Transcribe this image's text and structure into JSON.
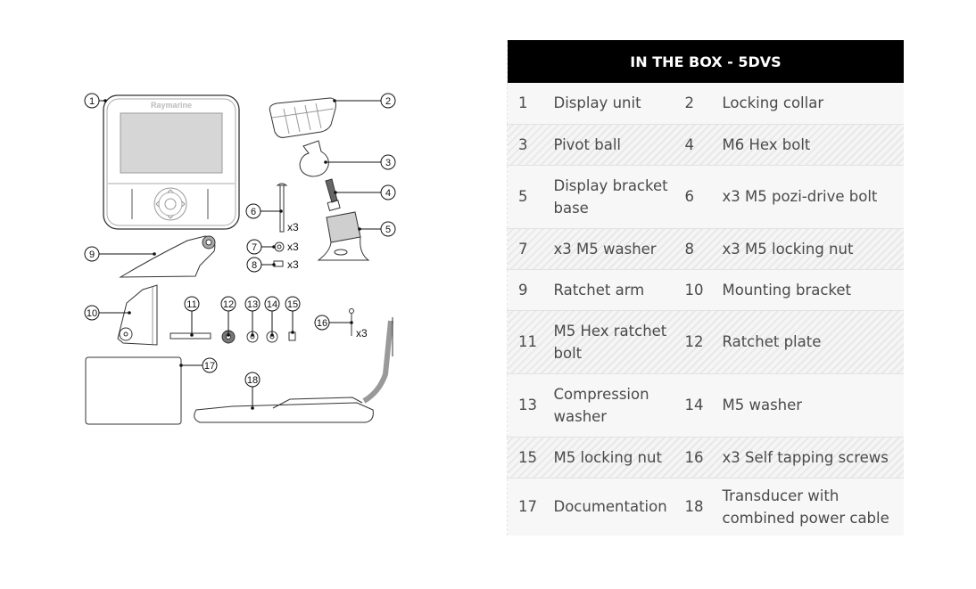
{
  "table": {
    "title": "IN THE BOX - 5DVS",
    "rows": [
      {
        "n1": "1",
        "l1": "Display unit",
        "n2": "2",
        "l2": "Locking collar"
      },
      {
        "n1": "3",
        "l1": "Pivot ball",
        "n2": "4",
        "l2": "M6 Hex bolt"
      },
      {
        "n1": "5",
        "l1": "Display bracket base",
        "n2": "6",
        "l2": "x3 M5 pozi-drive bolt"
      },
      {
        "n1": "7",
        "l1": "x3 M5 washer",
        "n2": "8",
        "l2": "x3 M5 locking nut"
      },
      {
        "n1": "9",
        "l1": "Ratchet arm",
        "n2": "10",
        "l2": "Mounting bracket"
      },
      {
        "n1": "11",
        "l1": "M5 Hex ratchet bolt",
        "n2": "12",
        "l2": "Ratchet plate"
      },
      {
        "n1": "13",
        "l1": "Compression washer",
        "n2": "14",
        "l2": "M5 washer"
      },
      {
        "n1": "15",
        "l1": "M5 locking nut",
        "n2": "16",
        "l2": "x3 Self tapping screws"
      },
      {
        "n1": "17",
        "l1": "Documentation",
        "n2": "18",
        "l2": "Transducer with combined power cable"
      }
    ]
  },
  "diagram": {
    "brand": "Raymarine",
    "callouts": [
      "1",
      "2",
      "3",
      "4",
      "5",
      "6",
      "7",
      "8",
      "9",
      "10",
      "11",
      "12",
      "13",
      "14",
      "15",
      "16",
      "17",
      "18"
    ],
    "quantity_label": "x3"
  }
}
